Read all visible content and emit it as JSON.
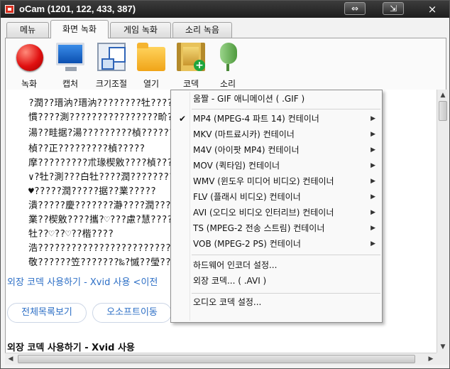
{
  "window": {
    "title": "oCam (1201, 122, 433, 387)",
    "btn_swap": "⇔",
    "btn_minimize": "⇲",
    "close": "×"
  },
  "tabs": [
    {
      "label": "메뉴",
      "active": false
    },
    {
      "label": "화면 녹화",
      "active": true
    },
    {
      "label": "게임 녹화",
      "active": false
    },
    {
      "label": "소리 녹음",
      "active": false
    }
  ],
  "toolbar": {
    "record": "녹화",
    "capture": "캡처",
    "resize": "크기조절",
    "open": "열기",
    "codec": "코덱",
    "sound": "소리"
  },
  "content": {
    "garbled_lines": [
      "?潤??瑨汭?瑨汭????????牡????????????????????????????",
      "慣????測????????????????畍??????????????????????畦据?",
      "湯??畦据?湯?????????楨???????????????????????????",
      "楨??正?????????楨?????",
      "摩?????????朮瑑楔敫????楨???????????????????????正",
      "∨?牡?測???白牡????潤????????????????????????据",
      "♥?????潤?????据??業?????",
      "潰?????慶???????瀞????潤???????????????????????獪?",
      "業??楔敫????攜?♡???慮?慧???????????????????湯?",
      "牡??♡??♡??楷????",
      "浩????????????????????????????????????????????????",
      "敬??????笠???????‰?慽??瑩??????????????????????"
    ],
    "link_text": "외장 코덱 사용하기 - Xvid 사용   <이전",
    "btn_list": "전체목록보기",
    "btn_osoft": "오소프트이동",
    "heading": "외장 코덱 사용하기 - Xvid 사용"
  },
  "menu": {
    "items": [
      {
        "label": "움짤 - GIF 애니메이션 ( .GIF )",
        "checked": false,
        "submenu": false
      },
      {
        "label": "MP4 (MPEG-4 파트 14) 컨테이너",
        "checked": true,
        "submenu": true
      },
      {
        "label": "MKV (마트료시카) 컨테이너",
        "checked": false,
        "submenu": true
      },
      {
        "label": "M4V (아이팟 MP4) 컨테이너",
        "checked": false,
        "submenu": true
      },
      {
        "label": "MOV (퀵타임) 컨테이너",
        "checked": false,
        "submenu": true
      },
      {
        "label": "WMV (윈도우 미디어 비디오) 컨테이너",
        "checked": false,
        "submenu": true
      },
      {
        "label": "FLV (플래시 비디오) 컨테이너",
        "checked": false,
        "submenu": true
      },
      {
        "label": "AVI (오디오 비디오 인터리브) 컨테이너",
        "checked": false,
        "submenu": true
      },
      {
        "label": "TS (MPEG-2 전송 스트림) 컨테이너",
        "checked": false,
        "submenu": true
      },
      {
        "label": "VOB (MPEG-2 PS) 컨테이너",
        "checked": false,
        "submenu": true
      },
      {
        "label": "하드웨어 인코더 설정...",
        "checked": false,
        "submenu": false
      },
      {
        "label": "외장 코덱... ( .AVI )",
        "checked": false,
        "submenu": false
      },
      {
        "label": "오디오 코덱 설정...",
        "checked": false,
        "submenu": false
      }
    ],
    "check_glyph": "✔",
    "arrow_glyph": "▶"
  },
  "scroll": {
    "up": "▲",
    "down": "▼",
    "left": "◀",
    "right": "▶"
  }
}
